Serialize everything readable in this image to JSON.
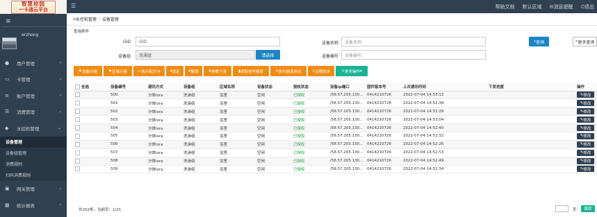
{
  "logo": {
    "line1": "智慧校园",
    "line2": "一卡通云平台"
  },
  "sidebar": {
    "username": "erzhong",
    "items": [
      {
        "icon": "user-icon",
        "glyph": "●",
        "label": "用户管理"
      },
      {
        "icon": "card-icon",
        "glyph": "▭",
        "label": "卡管理"
      },
      {
        "icon": "account-icon",
        "glyph": "≡",
        "label": "账户管理"
      },
      {
        "icon": "cart-icon",
        "glyph": "☰",
        "label": "消费管理"
      },
      {
        "icon": "water-icon",
        "glyph": "◆",
        "label": "水控机管理"
      }
    ],
    "sub_items": [
      "设备管理",
      "设备组管理",
      "消费规则",
      "扫码消费规则"
    ],
    "items_after": [
      {
        "icon": "gateway-icon",
        "glyph": "▣",
        "label": "网关管理"
      },
      {
        "icon": "report-icon",
        "glyph": "▦",
        "label": "统计报表"
      }
    ]
  },
  "topbar": {
    "links": [
      "帮助文档",
      "默认区域",
      "消息提醒",
      "退出"
    ]
  },
  "breadcrumb": {
    "home": "水控机管理",
    "current": "设备管理"
  },
  "section_title": "查询条件",
  "filters": {
    "gid_label": "GID",
    "gid_placeholder": "GID",
    "name_label": "设备名称",
    "name_placeholder": "设备名称",
    "group_label": "设备组",
    "group_value": "洗澡组",
    "select_button": "请选择",
    "no_label": "设备编号",
    "no_placeholder": "设备编号",
    "search_button": "查询",
    "more_button": "更多查询"
  },
  "toolbar": [
    "设备分组",
    "区域分组",
    "执行配对卡",
    "锁定",
    "解锁",
    "参数下发",
    "读取信号强度",
    "执行结束用水",
    "远程放水"
  ],
  "toolbar_more": "更多操作",
  "table": {
    "headers": [
      "全选",
      "设备编号",
      "通讯方式",
      "设备组",
      "区域名称",
      "设备状态",
      "授权状态",
      "设备ip端口",
      "固件版本号",
      "上次通讯时间",
      "下发进度",
      "操作"
    ],
    "rows": [
      [
        "500",
        "分体lora",
        "洗澡组",
        "浴室",
        "空闲",
        "已授权",
        "/58.57.205.130...",
        "0414210726",
        "2022-07-04 14:53:12",
        ""
      ],
      [
        "501",
        "分体lora",
        "洗澡组",
        "浴室",
        "空闲",
        "已授权",
        "/58.57.205.130...",
        "0414210726",
        "2022-07-04 14:52:39",
        ""
      ],
      [
        "502",
        "分体lora",
        "洗澡组",
        "浴室",
        "空闲",
        "已授权",
        "/58.57.205.130...",
        "0414210726",
        "2022-07-04 14:52:29",
        ""
      ],
      [
        "503",
        "分体lora",
        "洗澡组",
        "浴室",
        "空闲",
        "已授权",
        "/58.57.205.130...",
        "0414210726",
        "2022-07-04 14:53:04",
        ""
      ],
      [
        "504",
        "分体lora",
        "洗澡组",
        "浴室",
        "空闲",
        "已授权",
        "/58.57.205.130...",
        "0414210726",
        "2022-07-04 14:52:40",
        ""
      ],
      [
        "505",
        "分体lora",
        "洗澡组",
        "浴室",
        "空闲",
        "已授权",
        "/58.57.205.130...",
        "0414210726",
        "2022-07-04 14:52:32",
        ""
      ],
      [
        "506",
        "分体lora",
        "洗澡组",
        "浴室",
        "空闲",
        "已授权",
        "/58.57.205.130...",
        "0414210726",
        "2022-07-04 14:52:26",
        ""
      ],
      [
        "507",
        "分体lora",
        "洗澡组",
        "浴室",
        "空闲",
        "已授权",
        "/58.57.205.130...",
        "0414210726",
        "2022-07-04 14:52:53",
        ""
      ],
      [
        "508",
        "分体lora",
        "洗澡组",
        "浴室",
        "空闲",
        "已授权",
        "/58.57.205.130...",
        "0414210726",
        "2022-07-04 14:52:49",
        ""
      ],
      [
        "509",
        "分体lora",
        "洗澡组",
        "浴室",
        "空闲",
        "已授权",
        "/58.57.205.130...",
        "0414210726",
        "2022-07-04 14:52:34",
        ""
      ]
    ],
    "edit_label": "修改"
  },
  "pager": {
    "summary": "共202条，当前页：1/21",
    "unit": "页",
    "go": "跳转"
  },
  "colors": {
    "sidebar": "#2f4050",
    "orange": "#f08c16",
    "green": "#1ab394",
    "blue": "#1c84c6"
  }
}
